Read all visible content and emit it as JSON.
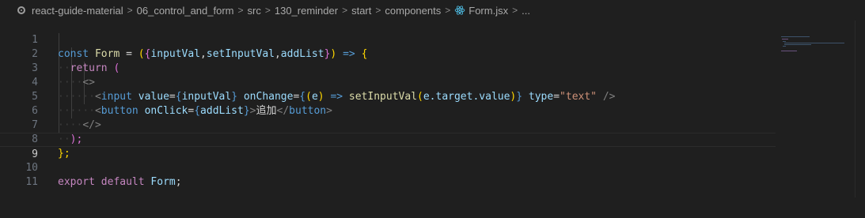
{
  "breadcrumb": {
    "items": [
      "react-guide-material",
      "06_control_and_form",
      "src",
      "130_reminder",
      "start",
      "components"
    ],
    "file": "Form.jsx",
    "more": "...",
    "separator": ">"
  },
  "editor": {
    "current_line": 9,
    "line_numbers": [
      "1",
      "2",
      "3",
      "4",
      "5",
      "6",
      "7",
      "8",
      "9",
      "10",
      "11"
    ],
    "tokens": {
      "const": "const",
      "Form": "Form",
      "eq": "=",
      "open_paren": "(",
      "open_brace": "{",
      "inputVal": "inputVal",
      "comma": ",",
      "setInputVal": "setInputVal",
      "addList": "addList",
      "close_brace": "}",
      "close_paren": ")",
      "arrow": "=>",
      "return": "return",
      "frag_open": "<>",
      "lt": "<",
      "input": "input",
      "value": "value",
      "onChange": "onChange",
      "e": "e",
      "target_value": ".target.value",
      "type": "type",
      "text_str": "\"text\"",
      "self_close": "/>",
      "button": "button",
      "onClick": "onClick",
      "button_text": "追加",
      "close_button": "</",
      "gt": ">",
      "frag_close": "</>",
      "close_return": ");",
      "close_block": "};",
      "export": "export",
      "default": "default",
      "semicolon": ";",
      "dot": "·"
    }
  },
  "colors": {
    "background": "#1f1f1f",
    "keyword": "#569cd6",
    "control": "#c586c0",
    "function": "#dcdcaa",
    "variable": "#9cdcfe",
    "string": "#ce9178",
    "bracket1": "#ffd700",
    "bracket2": "#da70d6",
    "bracket3": "#179fff"
  },
  "icons": {
    "root": "circle-dot-icon",
    "file": "react-icon"
  }
}
